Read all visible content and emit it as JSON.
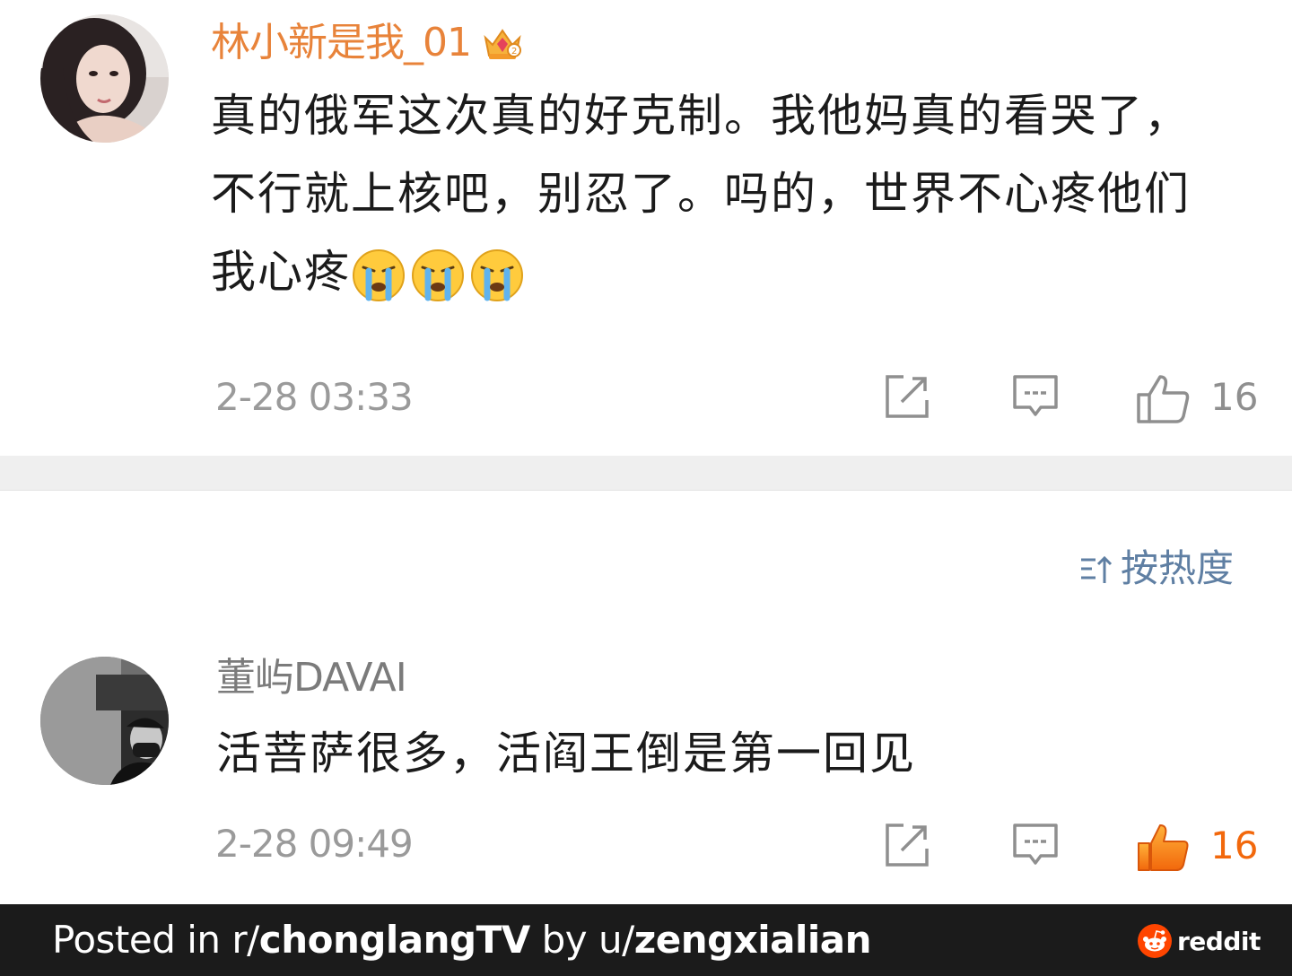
{
  "comments": [
    {
      "username": "林小新是我_01",
      "username_color": "#e8833a",
      "text": "真的俄军这次真的好克制。我他妈真的看哭了，不行就上核吧，别忍了。吗的，世界不心疼他们我心疼",
      "emoji": "crying-emoji",
      "timestamp": "2-28 03:33",
      "like_count": "16",
      "liked": false
    },
    {
      "username": "董屿DAVAI",
      "username_color": "#7b7b7b",
      "text": "活菩萨很多，活阎王倒是第一回见",
      "timestamp": "2-28 09:49",
      "like_count": "16",
      "liked": true
    }
  ],
  "sort": {
    "label": "按热度",
    "icon": "sort-icon",
    "color": "#5f7fa3"
  },
  "footer": {
    "posted_in_prefix": "Posted in r/",
    "subreddit": "chonglangTV",
    "by_prefix": " by u/",
    "username": "zengxialian",
    "brand": "reddit"
  },
  "colors": {
    "like_active": "#f2680c",
    "icon_gray": "#8f8f8f",
    "footer_bg": "#1b1b1b"
  }
}
